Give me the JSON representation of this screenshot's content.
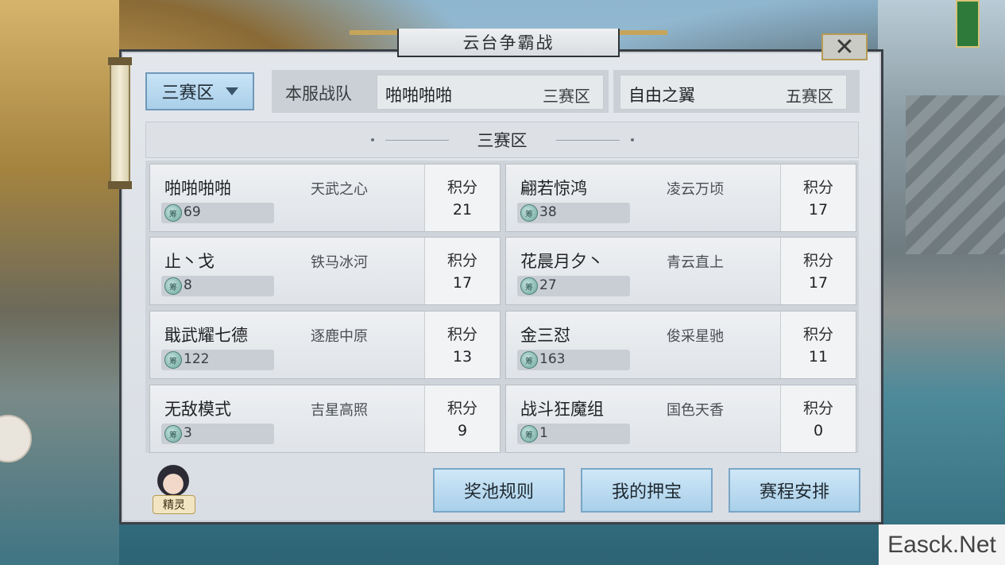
{
  "window": {
    "title": "云台争霸战",
    "close_symbol": "✕"
  },
  "region_select": {
    "value": "三赛区"
  },
  "server": {
    "label": "本服战队",
    "team": {
      "name": "啪啪啪啪",
      "zone": "三赛区"
    }
  },
  "opponent": {
    "name": "自由之翼",
    "zone": "五赛区"
  },
  "section": {
    "title": "三赛区"
  },
  "teams": [
    {
      "name": "啪啪啪啪",
      "server": "天武之心",
      "bets": "69",
      "score_label": "积分",
      "score": "21"
    },
    {
      "name": "翩若惊鸿",
      "server": "凌云万顷",
      "bets": "38",
      "score_label": "积分",
      "score": "17"
    },
    {
      "name": "止丶戈",
      "server": "铁马冰河",
      "bets": "8",
      "score_label": "积分",
      "score": "17"
    },
    {
      "name": "花晨月夕丶",
      "server": "青云直上",
      "bets": "27",
      "score_label": "积分",
      "score": "17"
    },
    {
      "name": "戢武耀七德",
      "server": "逐鹿中原",
      "bets": "122",
      "score_label": "积分",
      "score": "13"
    },
    {
      "name": "金三怼",
      "server": "俊采星驰",
      "bets": "163",
      "score_label": "积分",
      "score": "11"
    },
    {
      "name": "无敌模式",
      "server": "吉星高照",
      "bets": "3",
      "score_label": "积分",
      "score": "9"
    },
    {
      "name": "战斗狂魔组",
      "server": "国色天香",
      "bets": "1",
      "score_label": "积分",
      "score": "0"
    }
  ],
  "coin_glyph": "筹",
  "sprite": {
    "label": "精灵"
  },
  "buttons": {
    "prize_rules": "奖池规则",
    "my_bets": "我的押宝",
    "schedule": "赛程安排"
  },
  "watermark": "Easck.Net",
  "colors": {
    "button_blue": "#a9d0ea",
    "frame_gold": "#c6a55a"
  }
}
